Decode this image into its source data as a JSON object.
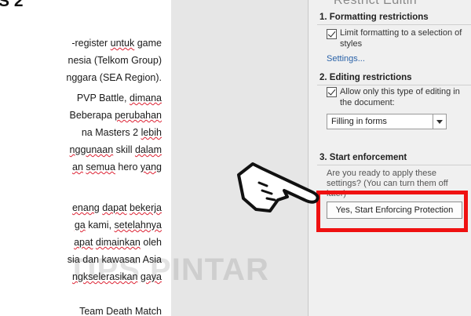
{
  "document": {
    "heading": "S 2",
    "lines": [
      {
        "parts": [
          {
            "t": "-register ",
            "s": false
          },
          {
            "t": "untuk",
            "s": true
          },
          {
            "t": " game",
            "s": false
          }
        ]
      },
      {
        "parts": [
          {
            "t": "nesia (Telkom Group)",
            "s": false
          }
        ]
      },
      {
        "parts": [
          {
            "t": "nggara (SEA Region).",
            "s": false
          }
        ]
      },
      {
        "parts": [
          {
            "t": "PVP Battle, ",
            "s": false
          },
          {
            "t": "dimana",
            "s": true
          }
        ]
      },
      {
        "parts": [
          {
            "t": "Beberapa ",
            "s": false
          },
          {
            "t": "perubahan",
            "s": true
          }
        ]
      },
      {
        "parts": [
          {
            "t": "na Masters 2 ",
            "s": false
          },
          {
            "t": "lebih",
            "s": true
          }
        ]
      },
      {
        "parts": [
          {
            "t": "nggunaan",
            "s": true
          },
          {
            "t": " skill ",
            "s": false
          },
          {
            "t": "dalam",
            "s": true
          }
        ]
      },
      {
        "parts": [
          {
            "t": "an",
            "s": true
          },
          {
            "t": " ",
            "s": false
          },
          {
            "t": "semua",
            "s": true
          },
          {
            "t": " hero ",
            "s": false
          },
          {
            "t": "yang",
            "s": true
          }
        ]
      },
      {
        "parts": [
          {
            "t": "enang",
            "s": true
          },
          {
            "t": " ",
            "s": false
          },
          {
            "t": "dapat",
            "s": true
          },
          {
            "t": " ",
            "s": false
          },
          {
            "t": "bekerja",
            "s": true
          }
        ]
      },
      {
        "parts": [
          {
            "t": "ga",
            "s": true
          },
          {
            "t": " kami, ",
            "s": false
          },
          {
            "t": "setelahnya",
            "s": true
          }
        ]
      },
      {
        "parts": [
          {
            "t": "apat",
            "s": true
          },
          {
            "t": " ",
            "s": false
          },
          {
            "t": "dimainkan",
            "s": true
          },
          {
            "t": " oleh",
            "s": false
          }
        ]
      },
      {
        "parts": [
          {
            "t": "sia dan kawasan Asia",
            "s": false
          }
        ]
      },
      {
        "parts": [
          {
            "t": "ngkselerasikan",
            "s": true
          },
          {
            "t": " ",
            "s": false
          },
          {
            "t": "gaya",
            "s": true
          }
        ]
      },
      {
        "parts": [
          {
            "t": "Team Death Match",
            "s": false
          }
        ]
      }
    ]
  },
  "pane": {
    "title": "Restrict Editin",
    "section1": {
      "header": "1. Formatting restrictions",
      "checkbox_label": "Limit formatting to a selection of styles",
      "checked": true,
      "settings_link": "Settings..."
    },
    "section2": {
      "header": "2. Editing restrictions",
      "checkbox_label": "Allow only this type of editing in the document:",
      "checked": true,
      "dropdown_value": "Filling in forms"
    },
    "section3": {
      "header": "3. Start enforcement",
      "question": "Are you ready to apply these settings? (You can turn them off later)",
      "button_label": "Yes, Start Enforcing Protection"
    }
  },
  "watermark": "TIPS PINTAR",
  "colors": {
    "highlight": "#ef1111",
    "link": "#2a62a8",
    "pane_background": "#f0f0f0",
    "pasteboard": "#e6e6e6"
  },
  "icons": {
    "pointer": "pointing-hand-icon",
    "checkmark": "checkmark-icon",
    "dropdown": "chevron-down-icon"
  }
}
